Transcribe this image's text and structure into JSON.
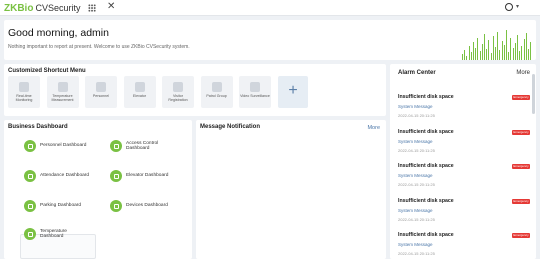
{
  "header": {
    "logo_mark": "ZKBio",
    "app_name": "CVSecurity",
    "grid_icon": "grid-icon",
    "close_icon": "close-icon",
    "user_icon": "user-icon"
  },
  "banner": {
    "greeting": "Good morning, admin",
    "subtitle": "Nothing important to report at present. Welcome to use ZKBio CVSecurity system."
  },
  "shortcut": {
    "title": "Customized Shortcut Menu",
    "items": [
      {
        "label": "Real-time Monitoring"
      },
      {
        "label": "Temperature Measurement"
      },
      {
        "label": "Personnel"
      },
      {
        "label": "Elevator"
      },
      {
        "label": "Visitor Registration"
      },
      {
        "label": "Patrol Group"
      },
      {
        "label": "Video Surveillance"
      }
    ],
    "add_label": "+"
  },
  "dashboard": {
    "title": "Business Dashboard",
    "items": [
      {
        "label": "Personnel Dashboard",
        "icon": "personnel-icon"
      },
      {
        "label": "Access Control Dashboard",
        "icon": "access-icon"
      },
      {
        "label": "Attendance Dashboard",
        "icon": "attendance-icon"
      },
      {
        "label": "Elevator Dashboard",
        "icon": "elevator-icon"
      },
      {
        "label": "Parking Dashboard",
        "icon": "parking-icon"
      },
      {
        "label": "Devices Dashboard",
        "icon": "devices-icon"
      },
      {
        "label": "Temperature Dashboard",
        "icon": "temperature-icon"
      }
    ]
  },
  "message": {
    "title": "Message Notification",
    "more": "More"
  },
  "alarm": {
    "title": "Alarm Center",
    "more": "More",
    "entries": [
      {
        "title": "Insufficient disk space",
        "badge": "Emergency",
        "source": "System Message",
        "time": "2022-04-15 20:11:25"
      },
      {
        "title": "Insufficient disk space",
        "badge": "Emergency",
        "source": "System Message",
        "time": "2022-04-15 20:11:25"
      },
      {
        "title": "Insufficient disk space",
        "badge": "Emergency",
        "source": "System Message",
        "time": "2022-04-15 20:11:25"
      },
      {
        "title": "Insufficient disk space",
        "badge": "Emergency",
        "source": "System Message",
        "time": "2022-04-15 20:11:25"
      },
      {
        "title": "Insufficient disk space",
        "badge": "Emergency",
        "source": "System Message",
        "time": "2022-04-15 20:11:25"
      }
    ]
  },
  "colors": {
    "accent": "#7ac143",
    "link": "#4a76a8",
    "badge": "#e53935"
  }
}
